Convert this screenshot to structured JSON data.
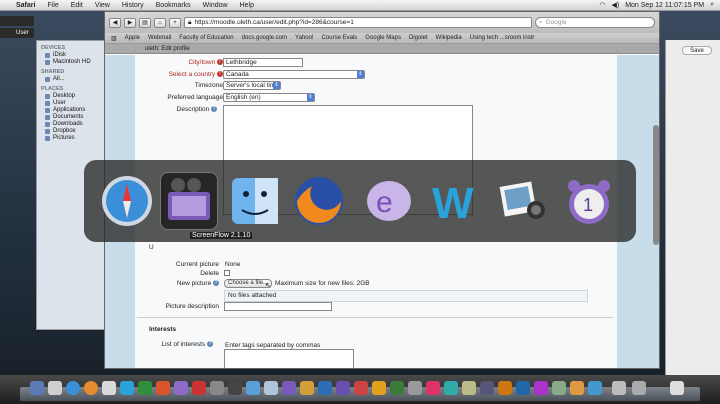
{
  "menubar": {
    "app": "Safari",
    "items": [
      "File",
      "Edit",
      "View",
      "History",
      "Bookmarks",
      "Window",
      "Help"
    ],
    "clock": "Mon Sep 12  11:07:15 PM"
  },
  "window": {
    "title": "uleth: Edit profile",
    "url": "https://moodle.uleth.ca/user/edit.php?id=286&course=1",
    "search_placeholder": "Google",
    "tab_title": "uleth: Edit profile",
    "bookmarks": [
      "Apple",
      "Webmail",
      "Faculty of Education",
      "docs.google.com",
      "Yahoo!",
      "Course Evals",
      "Google Maps",
      "Digolet",
      "Wikipedia",
      "Using tech ...sroom instr"
    ]
  },
  "finder": {
    "devices_label": "DEVICES",
    "devices": [
      "iDisk",
      "Macintosh HD"
    ],
    "shared_label": "SHARED",
    "shared": [
      "All..."
    ],
    "places_label": "PLACES",
    "places": [
      "Desktop",
      "User",
      "Applications",
      "Documents",
      "Downloads",
      "Dropbox",
      "Pictures"
    ]
  },
  "leftmini": {
    "label": "User"
  },
  "rightwin": {
    "save": "Save"
  },
  "form": {
    "city_label": "City/town",
    "city_value": "Lethbridge",
    "country_label": "Select a country",
    "country_value": "Canada",
    "timezone_label": "Timezone",
    "timezone_value": "Server's local time",
    "language_label": "Preferred language",
    "language_value": "English (en)",
    "description_label": "Description",
    "user_section_letter": "U",
    "current_picture_label": "Current picture",
    "current_picture_value": "None",
    "delete_label": "Delete",
    "new_picture_label": "New picture",
    "choose_file": "Choose a file...",
    "max_size": "Maximum size for new files: 2GB",
    "no_files": "No files attached",
    "picture_desc_label": "Picture description",
    "interests_heading": "Interests",
    "interests_label": "List of interests",
    "interests_hint": "Enter tags separated by commas"
  },
  "switcher": {
    "selected_label": "ScreenFlow 2.1.10",
    "apps": [
      "safari-icon",
      "screenflow-icon",
      "finder-icon",
      "firefox-icon",
      "eclipse-e-icon",
      "word-icon",
      "iphoto-icon",
      "alarm-clock-icon"
    ]
  },
  "colors": {
    "menubar": "#dcdcdc",
    "page_blue": "#c8ddea",
    "required_red": "#b3261e",
    "help_blue": "#5e88b5",
    "switcher_bg": "#282828"
  }
}
